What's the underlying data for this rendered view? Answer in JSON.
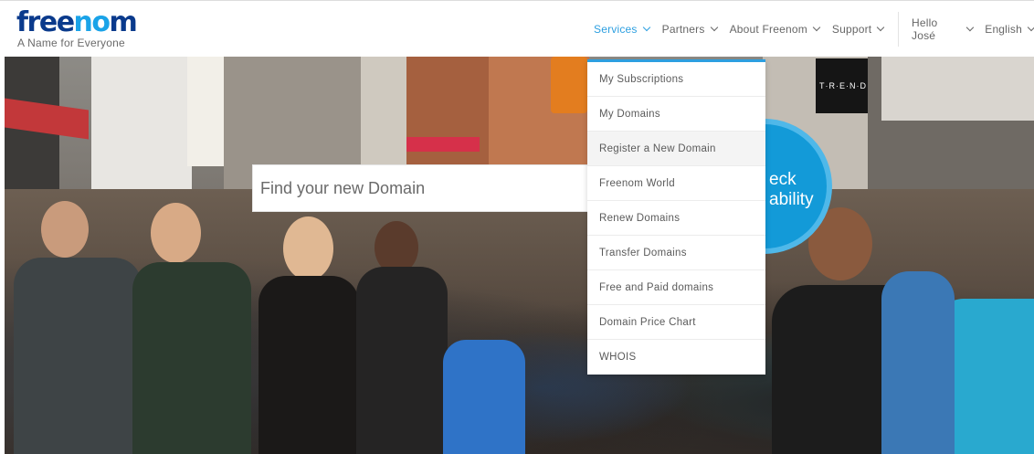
{
  "brand": {
    "logo_prefix": "free",
    "logo_accent": "no",
    "logo_suffix": "m",
    "tagline": "A Name for Everyone",
    "colors": {
      "navy": "#0a3a8c",
      "sky": "#1aa3e8"
    }
  },
  "nav": {
    "items": [
      {
        "label": "Services",
        "active": true
      },
      {
        "label": "Partners"
      },
      {
        "label": "About Freenom"
      },
      {
        "label": "Support"
      }
    ],
    "user": [
      {
        "label": "Hello José"
      },
      {
        "label": "English"
      }
    ]
  },
  "services_menu": [
    "My Subscriptions",
    "My Domains",
    "Register a New Domain",
    "Freenom World",
    "Renew Domains",
    "Transfer Domains",
    "Free and Paid domains",
    "Domain Price Chart",
    "WHOIS"
  ],
  "hero": {
    "search_placeholder": "Find your new Domain",
    "check_button": "eck\nability",
    "storefront_sign": "T·R·E·N·D"
  },
  "colors": {
    "accent": "#2d9fe0",
    "button": "#139ad8"
  }
}
